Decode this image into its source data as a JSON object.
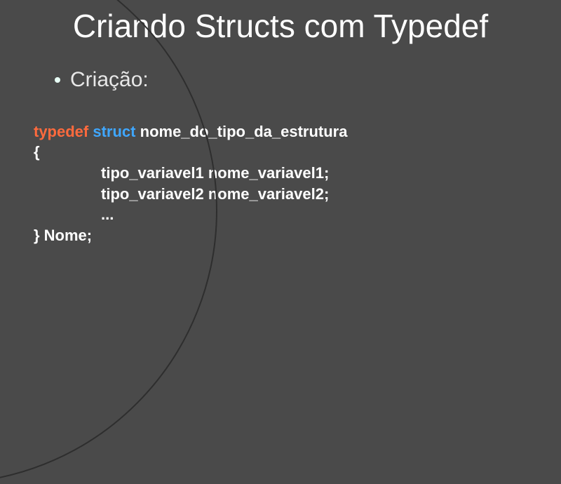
{
  "slide": {
    "title": "Criando Structs com Typedef",
    "bullet": "Criação:",
    "code": {
      "typedef": "typedef",
      "struct": "struct",
      "struct_name": "nome_do_tipo_da_estrutura",
      "open_brace": "{",
      "field1": "tipo_variavel1 nome_variavel1;",
      "field2": "tipo_variavel2 nome_variavel2;",
      "ellipsis": "...",
      "close": "} Nome;"
    }
  }
}
